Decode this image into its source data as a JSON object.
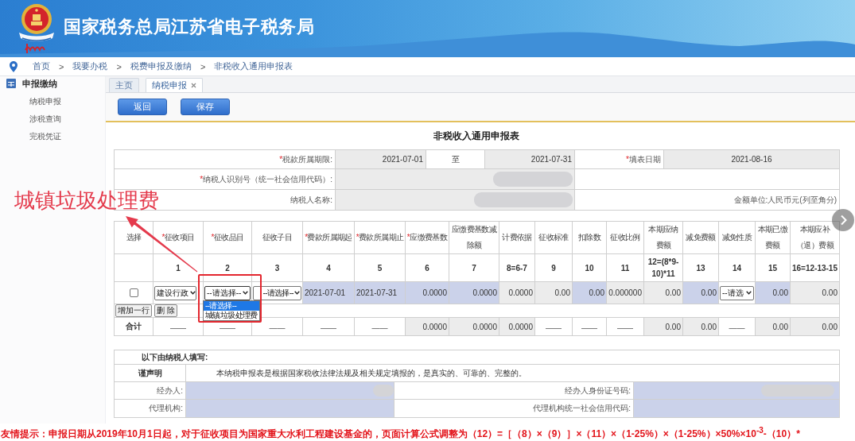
{
  "header": {
    "title": "国家税务总局江苏省电子税务局"
  },
  "breadcrumb": [
    {
      "label": "首页"
    },
    {
      "separator": ">",
      "label": "我要办税"
    },
    {
      "separator": ">",
      "label": "税费申报及缴纳"
    },
    {
      "separator": ">",
      "label": "非税收入通用申报表"
    }
  ],
  "sidebar": {
    "group": "申报缴纳",
    "items": [
      "纳税申报",
      "涉税查询",
      "完税凭证"
    ]
  },
  "tabs": [
    {
      "label": "主页",
      "selected": false,
      "closable": false
    },
    {
      "label": "纳税申报",
      "selected": true,
      "closable": true
    }
  ],
  "toolbar": {
    "buttons": [
      "返回",
      "保存"
    ]
  },
  "form_title": "非税收入通用申报表",
  "report_info": {
    "period_label": {
      "required_mark": "*",
      "text": "税款所属期限:"
    },
    "period_start": "2021-07-01",
    "period_to": "至",
    "period_end": "2021-07-31",
    "fill_date_label": {
      "required_mark": "*",
      "text": "填表日期"
    },
    "fill_date": "2021-08-16",
    "taxpayer_id_label": {
      "required_mark": "*",
      "text": "纳税人识别号（统一社会信用代码）:"
    },
    "taxpayer_id_redacted": true,
    "taxpayer_name_label": {
      "text": "纳税人名称:"
    },
    "taxpayer_name_redacted": true,
    "currency_note": "金额单位:人民币元(列至角分)"
  },
  "fee_table": {
    "columns": [
      {
        "label": {
          "text": "选择"
        }
      },
      {
        "label": {
          "required_mark": "*",
          "text": "征收项目"
        },
        "number": "1"
      },
      {
        "label": {
          "required_mark": "*",
          "text": "征收品目"
        },
        "number": "2"
      },
      {
        "label": {
          "text": "征收子目"
        },
        "number": "3"
      },
      {
        "label": {
          "required_mark": "*",
          "text": "费款所属期起"
        },
        "number": "4"
      },
      {
        "label": {
          "required_mark": "*",
          "text": "费款所属期止"
        },
        "number": "5"
      },
      {
        "label": {
          "required_mark": "*",
          "text": "应缴费基数"
        },
        "number": "6"
      },
      {
        "label": {
          "text": "应缴费基数减除额"
        },
        "number": "7"
      },
      {
        "label": {
          "text": "计费依据"
        },
        "number": "8=6-7"
      },
      {
        "label": {
          "text": "征收标准"
        },
        "number": "9"
      },
      {
        "label": {
          "text": "扣除数"
        },
        "number": "10"
      },
      {
        "label": {
          "text": "征收比例"
        },
        "number": "11"
      },
      {
        "label": {
          "text": "本期应纳费额"
        },
        "number": "12=(8*9-10)*11"
      },
      {
        "label": {
          "text": "减免费额"
        },
        "number": "13"
      },
      {
        "label": {
          "text": "减免性质"
        },
        "number": "14"
      },
      {
        "label": {
          "text": "本期已缴费额"
        },
        "number": "15"
      },
      {
        "label": {
          "text": "本期应补（退）费额"
        },
        "number": "16=12-13-15"
      }
    ],
    "rows": [
      {
        "kind": "entry",
        "cells": [
          {
            "kind": "checkbox",
            "checked": false
          },
          {
            "kind": "select",
            "value": "建设行政",
            "open": false
          },
          {
            "kind": "select",
            "value": "--请选择--",
            "open": true,
            "options": [
              {
                "label": "--请选择--",
                "selected": true
              },
              {
                "label": "城镇垃圾处理费",
                "selected": false
              }
            ]
          },
          {
            "kind": "select",
            "value": "--请选择--",
            "open": false
          },
          {
            "kind": "input",
            "value": "2021-07-01"
          },
          {
            "kind": "input",
            "value": "2021-07-31"
          },
          {
            "kind": "input",
            "value": "0.0000"
          },
          {
            "kind": "input",
            "value": "0.0000"
          },
          {
            "kind": "computed",
            "value": "0.0000"
          },
          {
            "kind": "computed",
            "value": "0.00"
          },
          {
            "kind": "input",
            "value": "0.00"
          },
          {
            "kind": "computed",
            "value": "0.000000"
          },
          {
            "kind": "computed",
            "value": "0.00"
          },
          {
            "kind": "input",
            "value": "0.00"
          },
          {
            "kind": "select",
            "value": "--请选",
            "open": false
          },
          {
            "kind": "input",
            "value": "0.00"
          },
          {
            "kind": "computed",
            "value": "0.00"
          }
        ]
      },
      {
        "kind": "actions",
        "buttons": [
          "增加一行",
          "删 除"
        ]
      },
      {
        "kind": "total",
        "cells": [
          {
            "kind": "label",
            "value": "合计"
          },
          {
            "kind": "dash",
            "value": "——"
          },
          {
            "kind": "dash",
            "value": "——"
          },
          {
            "kind": "dash",
            "value": "——"
          },
          {
            "kind": "dash",
            "value": "——"
          },
          {
            "kind": "dash",
            "value": "——"
          },
          {
            "kind": "computed",
            "value": "0.0000"
          },
          {
            "kind": "computed",
            "value": "0.0000"
          },
          {
            "kind": "computed",
            "value": "0.0000"
          },
          {
            "kind": "dash",
            "value": "——"
          },
          {
            "kind": "dash",
            "value": "——"
          },
          {
            "kind": "dash",
            "value": "——"
          },
          {
            "kind": "computed",
            "value": "0.00"
          },
          {
            "kind": "computed",
            "value": "0.00"
          },
          {
            "kind": "dash",
            "value": "——"
          },
          {
            "kind": "computed",
            "value": "0.00"
          },
          {
            "kind": "computed",
            "value": "0.00"
          }
        ]
      }
    ]
  },
  "annotation": {
    "text": "城镇垃圾处理费"
  },
  "declaration": {
    "heading": "以下由纳税人填写:",
    "statement_label": "谨声明",
    "statement": "本纳税申报表是根据国家税收法律法规及相关规定填报的，是真实的、可靠的、完整的。",
    "fields": [
      {
        "label": "经办人:",
        "redacted": true
      },
      {
        "label": "经办人身份证号码:",
        "redacted": true
      },
      {
        "label": "代理机构:",
        "redacted": false
      },
      {
        "label": "代理机构统一社会信用代码:",
        "redacted": false
      }
    ]
  },
  "notice": "友情提示：申报日期从2019年10月1日起，对于征收项目为国家重大水利工程建设基金的，页面计算公式调整为（12）=［（8）×（9）］×（11）×（1-25%）×（1-25%）×50%×10$^{-3}$-（10）*"
}
